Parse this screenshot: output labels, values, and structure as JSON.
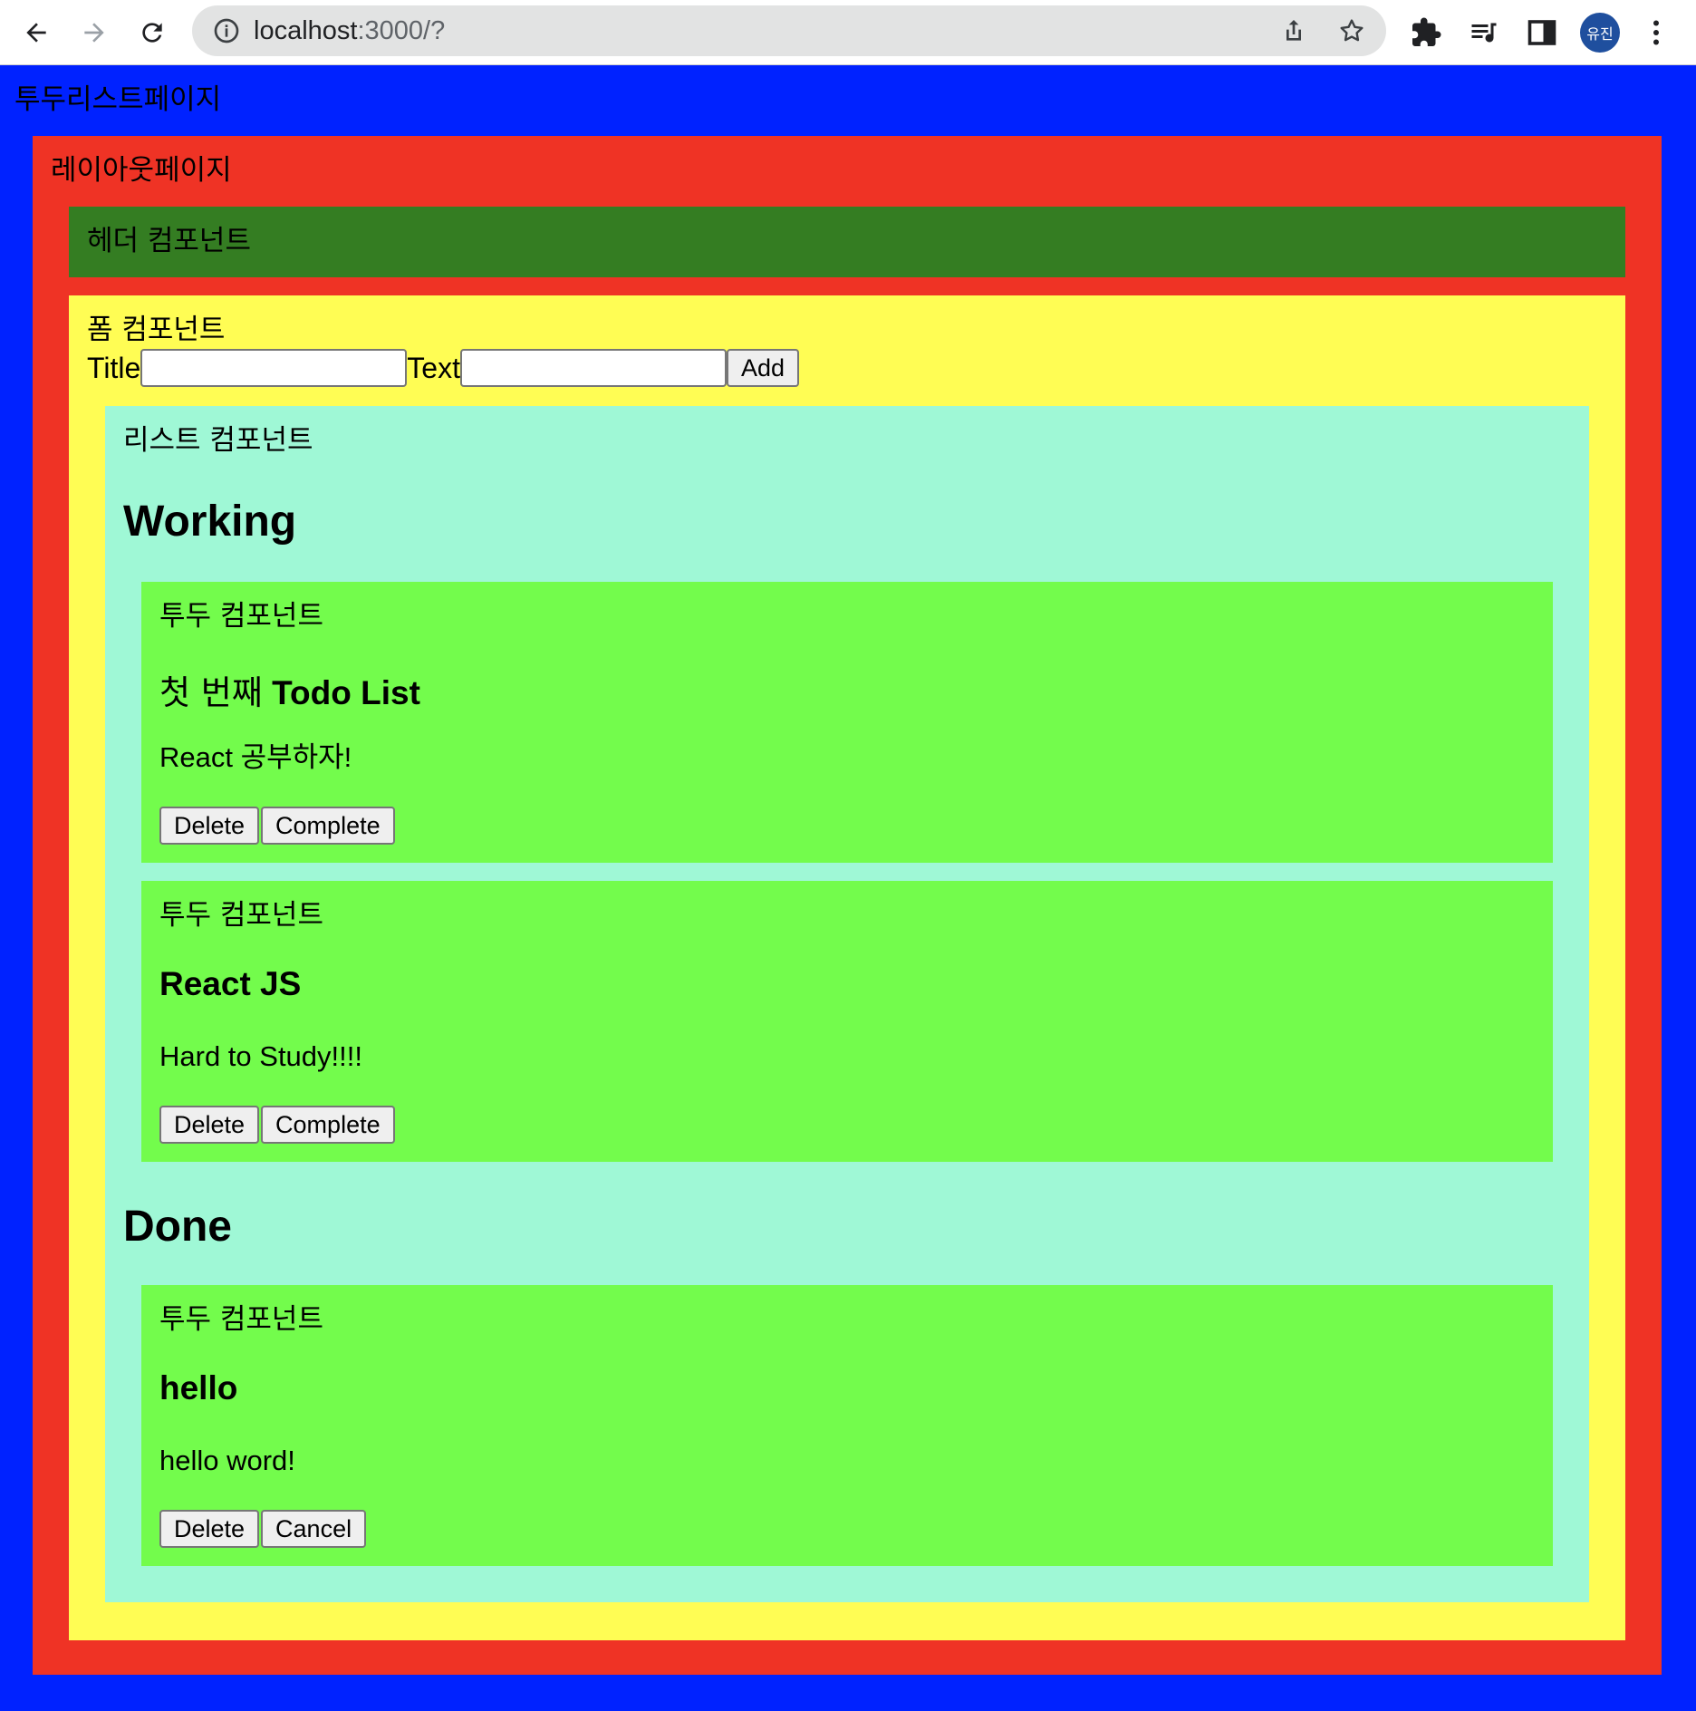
{
  "browser": {
    "url_host": "localhost",
    "url_path": ":3000/?",
    "profile_initials": "유진",
    "profile_color": "#1f4f9e"
  },
  "page": {
    "todo_page_title": "투두리스트페이지",
    "layout_title": "레이아웃페이지",
    "header_title": "헤더 컴포넌트",
    "form": {
      "title": "폼 컴포넌트",
      "title_label": "Title",
      "title_value": "",
      "text_label": "Text",
      "text_value": "",
      "add_label": "Add"
    },
    "list": {
      "title": "리스트 컴포넌트",
      "working_heading": "Working",
      "done_heading": "Done",
      "working": [
        {
          "component_label": "투두 컴포넌트",
          "title_prefix": "첫 번째",
          "title": "Todo List",
          "body": "React 공부하자!",
          "delete_label": "Delete",
          "toggle_label": "Complete"
        },
        {
          "component_label": "투두 컴포넌트",
          "title_prefix": "",
          "title": "React JS",
          "body": "Hard to Study!!!!",
          "delete_label": "Delete",
          "toggle_label": "Complete"
        }
      ],
      "done": [
        {
          "component_label": "투두 컴포넌트",
          "title_prefix": "",
          "title": "hello",
          "body": "hello word!",
          "delete_label": "Delete",
          "toggle_label": "Cancel"
        }
      ]
    }
  },
  "colors": {
    "todo_page_bg": "#0022ff",
    "layout_bg": "#ef3325",
    "header_bg": "#347d22",
    "form_bg": "#fffd54",
    "list_bg": "#9ff8d6",
    "todo_bg": "#73fc4c"
  }
}
